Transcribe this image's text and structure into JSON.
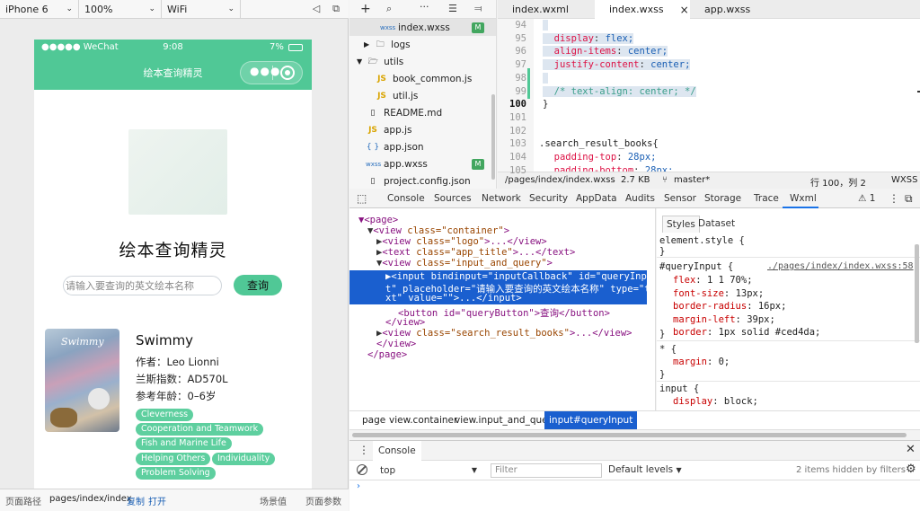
{
  "simulator": {
    "device": "iPhone 6",
    "zoom": "100%",
    "network": "WiFi",
    "status": {
      "carrier": "●●●●● WeChat",
      "time": "9:08",
      "battery": "7%"
    },
    "nav_title": "绘本查询精灵",
    "app_title": "绘本查询精灵",
    "search_placeholder": "请输入要查询的英文绘本名称",
    "search_button": "查询",
    "book": {
      "title": "Swimmy",
      "author": "作者：Leo Lionni",
      "lexile": "兰斯指数：AD570L",
      "age": "参考年龄：0–6岁",
      "cover_text": "Swimmy",
      "tags": [
        "Cleverness",
        "Cooperation and Teamwork",
        "Fish and Marine Life",
        "Helping Others",
        "Individuality",
        "Problem Solving"
      ]
    },
    "bottom": {
      "path_label": "页面路径",
      "path": "pages/index/index",
      "copy": "复制",
      "open": "打开",
      "scene": "场景值",
      "params": "页面参数"
    }
  },
  "tree": {
    "items": [
      {
        "name": "index.wxss",
        "type": "wxss",
        "badge": "M"
      },
      {
        "name": "logs",
        "type": "folder"
      },
      {
        "name": "utils",
        "type": "folder-open"
      },
      {
        "name": "book_common.js",
        "type": "js"
      },
      {
        "name": "util.js",
        "type": "js"
      },
      {
        "name": "README.md",
        "type": "file"
      },
      {
        "name": "app.js",
        "type": "js"
      },
      {
        "name": "app.json",
        "type": "json"
      },
      {
        "name": "app.wxss",
        "type": "wxss",
        "badge": "M"
      },
      {
        "name": "project.config.json",
        "type": "file"
      }
    ]
  },
  "editor": {
    "tabs": [
      "index.wxml",
      "index.wxss",
      "app.wxss"
    ],
    "close": "×",
    "lines": [
      {
        "n": "94",
        "prop": "",
        "val": ""
      },
      {
        "n": "95",
        "prop": "display",
        "val": "flex;"
      },
      {
        "n": "96",
        "prop": "align-items",
        "val": "center;"
      },
      {
        "n": "97",
        "prop": "justify-content",
        "val": "center;"
      },
      {
        "n": "98",
        "prop": "",
        "val": ""
      },
      {
        "n": "99",
        "comment": "/* text-align: center; */"
      },
      {
        "n": "100",
        "text": "}"
      },
      {
        "n": "101",
        "text": ""
      },
      {
        "n": "102",
        "text": ""
      },
      {
        "n": "103",
        "text": ".search_result_books{"
      },
      {
        "n": "104",
        "prop": "padding-top",
        "val": "28px;"
      },
      {
        "n": "105",
        "prop": "padding-bottom",
        "val": "28px;"
      }
    ],
    "status": {
      "path": "/pages/index/index.wxss",
      "size": "2.7 KB",
      "branch": "master*",
      "pos": "行 100，列 2",
      "lang": "WXSS"
    }
  },
  "devtools": {
    "tabs": [
      "Console",
      "Sources",
      "Network",
      "Security",
      "AppData",
      "Audits",
      "Sensor",
      "Storage",
      "Trace",
      "Wxml"
    ],
    "warn": "⚠ 1",
    "wxml": {
      "page_open": "<page>",
      "container": "class=\"container\"",
      "logo": "class=\"logo\"",
      "app_title": "class=\"app_title\"",
      "iq": "class=\"input_and_query\"",
      "input_line1": "<input bindinput=\"inputCallback\" id=\"queryInpu",
      "input_line2": "t\" placeholder=\"请输入要查询的英文绘本名称\" type=\"te",
      "input_line3": "xt\" value=\"\">...</input>",
      "button": "<button id=\"queryButton\">查询</button>",
      "view_close": "</view>",
      "results": "class=\"search_result_books\"",
      "page_close": "</page>"
    },
    "styles_tabs": [
      "Styles",
      "Dataset"
    ],
    "styles": {
      "element_style": "element.style {",
      "selector": "#queryInput {",
      "source": "./pages/index/index.wxss:58",
      "rules": [
        {
          "p": "flex",
          "v": "1 1 70%;"
        },
        {
          "p": "font-size",
          "v": "13px;"
        },
        {
          "p": "border-radius",
          "v": "16px;"
        },
        {
          "p": "margin-left",
          "v": "39px;"
        },
        {
          "p": "border",
          "v": "1px solid #ced4da;"
        }
      ],
      "star": "* {",
      "margin": "margin",
      "margin_v": "0;",
      "input_sel": "input {",
      "display": "display",
      "display_v": "block;"
    },
    "crumbs": [
      "page",
      "view.container",
      "view.input_and_query",
      "input#queryInput"
    ],
    "console": {
      "title": "Console",
      "context": "top",
      "filter_placeholder": "Filter",
      "levels": "Default levels",
      "hidden": "2 items hidden by filters"
    }
  }
}
